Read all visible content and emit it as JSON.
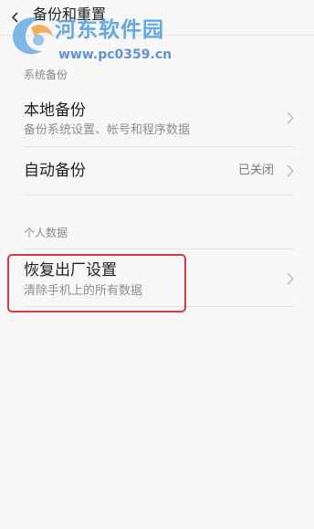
{
  "header": {
    "title": "备份和重置"
  },
  "sections": {
    "system_backup": {
      "label": "系统备份",
      "local_backup": {
        "title": "本地备份",
        "subtitle": "备份系统设置、帐号和程序数据"
      },
      "auto_backup": {
        "title": "自动备份",
        "value": "已关闭"
      }
    },
    "personal_data": {
      "label": "个人数据",
      "factory_reset": {
        "title": "恢复出厂设置",
        "subtitle": "清除手机上的所有数据"
      }
    }
  },
  "watermark": {
    "title": "河东软件园",
    "url": "www.pc0359.cn"
  },
  "colors": {
    "highlight": "#d83a45",
    "watermark": "#4a9ade"
  },
  "icons": [
    "back-arrow-icon",
    "chevron-right-icon",
    "watermark-logo-icon"
  ]
}
